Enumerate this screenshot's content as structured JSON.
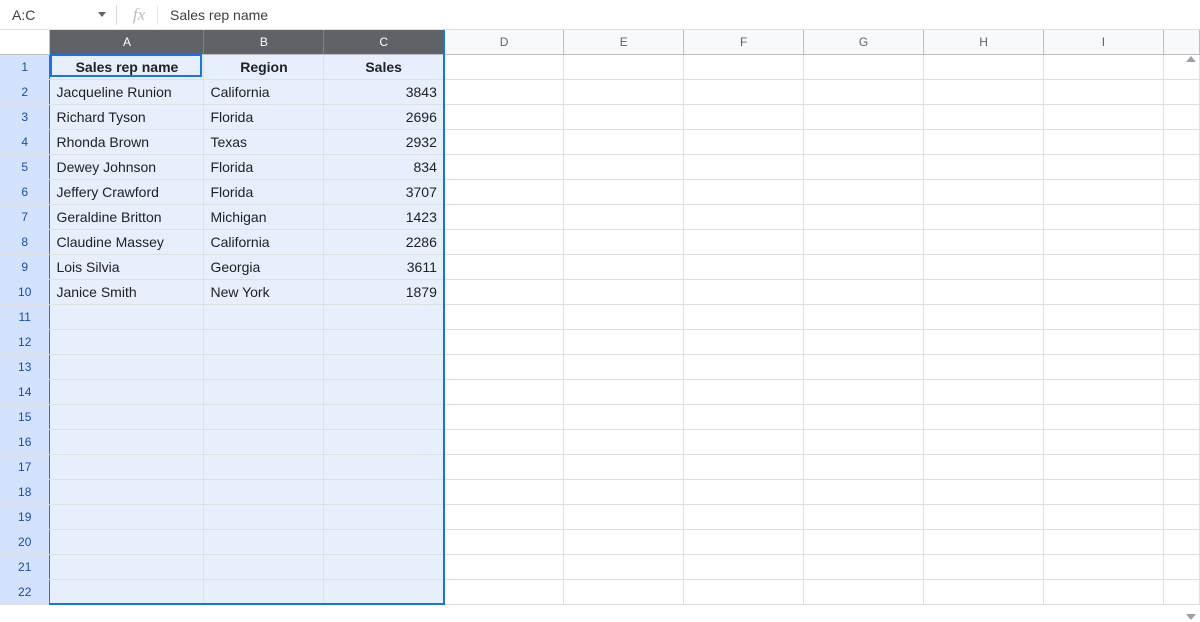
{
  "formula_bar": {
    "name_box_value": "A:C",
    "fx_label": "fx",
    "formula_value": "Sales rep name"
  },
  "columns": [
    "A",
    "B",
    "C",
    "D",
    "E",
    "F",
    "G",
    "H",
    "I"
  ],
  "selected_columns": [
    "A",
    "B",
    "C"
  ],
  "row_count": 22,
  "headers": {
    "A": "Sales rep name",
    "B": "Region",
    "C": "Sales"
  },
  "rows": [
    {
      "name": "Jacqueline Runion",
      "region": "California",
      "sales": 3843
    },
    {
      "name": "Richard Tyson",
      "region": "Florida",
      "sales": 2696
    },
    {
      "name": "Rhonda Brown",
      "region": "Texas",
      "sales": 2932
    },
    {
      "name": "Dewey Johnson",
      "region": "Florida",
      "sales": 834
    },
    {
      "name": "Jeffery Crawford",
      "region": "Florida",
      "sales": 3707
    },
    {
      "name": "Geraldine Britton",
      "region": "Michigan",
      "sales": 1423
    },
    {
      "name": "Claudine Massey",
      "region": "California",
      "sales": 2286
    },
    {
      "name": "Lois Silvia",
      "region": "Georgia",
      "sales": 3611
    },
    {
      "name": "Janice Smith",
      "region": "New York",
      "sales": 1879
    }
  ],
  "active_cell": "A1"
}
